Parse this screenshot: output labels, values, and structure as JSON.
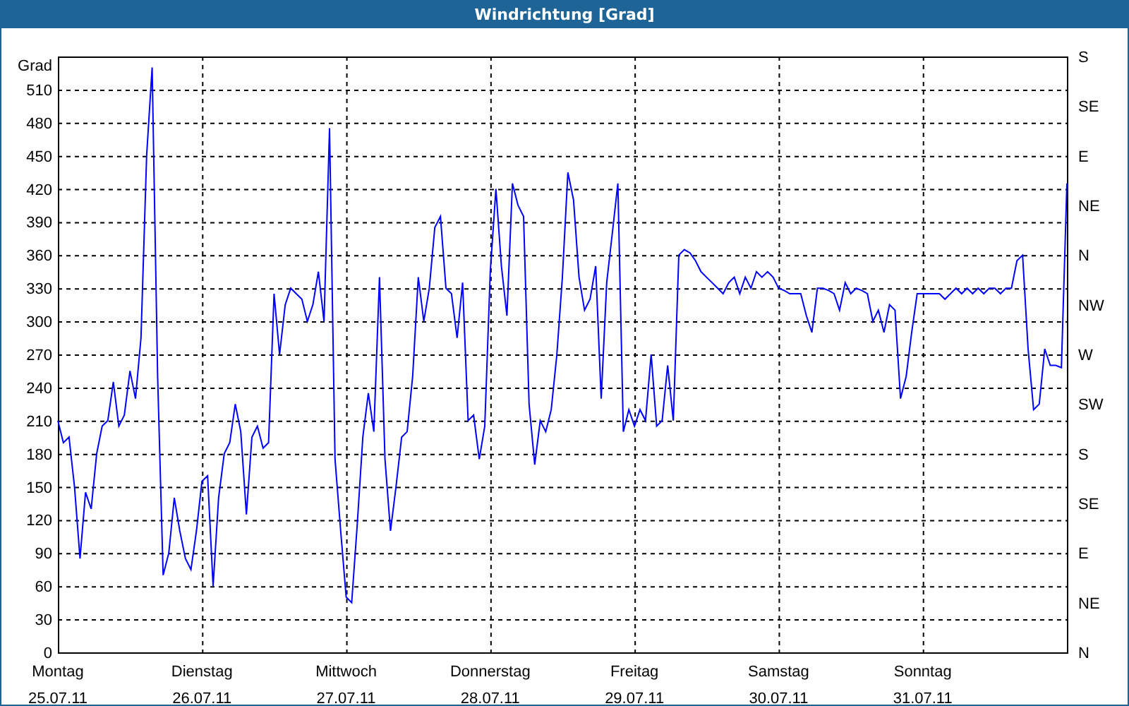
{
  "chart": {
    "chart_data": {
      "type": "line",
      "title": "Windrichtung [Grad]",
      "ylabel": "Grad",
      "categories": [
        "Montag\n25.07.11",
        null,
        null,
        null,
        null,
        null,
        null,
        null,
        null,
        null,
        null,
        null,
        null,
        null,
        null,
        null,
        null,
        null,
        null,
        null,
        null,
        null,
        null,
        null,
        null,
        null,
        "Dienstag\n26.07.11",
        null,
        null,
        null,
        null,
        null,
        null,
        null,
        null,
        null,
        null,
        null,
        null,
        null,
        null,
        null,
        null,
        null,
        null,
        null,
        null,
        null,
        null,
        null,
        null,
        null,
        "Mittwoch\n27.07.11",
        null,
        null,
        null,
        null,
        null,
        null,
        null,
        null,
        null,
        null,
        null,
        null,
        null,
        null,
        null,
        null,
        null,
        null,
        null,
        null,
        null,
        null,
        null,
        null,
        null,
        "Donnerstag\n28.07.11",
        null,
        null,
        null,
        null,
        null,
        null,
        null,
        null,
        null,
        null,
        null,
        null,
        null,
        null,
        null,
        null,
        null,
        null,
        null,
        null,
        null,
        null,
        null,
        null,
        null,
        "Freitag\n29.07.11",
        null,
        null,
        null,
        null,
        null,
        null,
        null,
        null,
        null,
        null,
        null,
        null,
        null,
        null,
        null,
        null,
        null,
        null,
        null,
        null,
        null,
        null,
        null,
        null,
        null,
        "Samstag\n30.07.11",
        null,
        null,
        null,
        null,
        null,
        null,
        null,
        null,
        null,
        null,
        null,
        null,
        null,
        null,
        null,
        null,
        null,
        null,
        null,
        null,
        null,
        null,
        null,
        null,
        null,
        "Sonntag\n31.07.11",
        null,
        null,
        null,
        null,
        null,
        null,
        null,
        null,
        null,
        null,
        null,
        null,
        null,
        null,
        null,
        null,
        null,
        null,
        null,
        null,
        null,
        null,
        null,
        null,
        null,
        null
      ],
      "series": [
        {
          "color": "#0000ff",
          "values": [
            210,
            190,
            195,
            150,
            85,
            145,
            130,
            180,
            205,
            210,
            245,
            205,
            215,
            255,
            230,
            285,
            450,
            530,
            250,
            70,
            90,
            140,
            110,
            85,
            75,
            110,
            155,
            160,
            60,
            140,
            180,
            190,
            225,
            200,
            125,
            195,
            205,
            185,
            190,
            325,
            270,
            315,
            330,
            325,
            320,
            300,
            315,
            345,
            300,
            475,
            175,
            110,
            50,
            45,
            115,
            195,
            235,
            200,
            340,
            175,
            110,
            150,
            195,
            200,
            250,
            340,
            300,
            330,
            385,
            395,
            330,
            325,
            285,
            335,
            210,
            215,
            175,
            205,
            345,
            420,
            350,
            305,
            425,
            405,
            395,
            225,
            170,
            210,
            200,
            220,
            270,
            340,
            435,
            410,
            340,
            310,
            320,
            350,
            230,
            335,
            380,
            425,
            200,
            220,
            205,
            220,
            210,
            270,
            205,
            210,
            260,
            210,
            360,
            365,
            362,
            355,
            345,
            340,
            335,
            330,
            325,
            335,
            340,
            325,
            340,
            330,
            345,
            340,
            345,
            340,
            330,
            328,
            325,
            325,
            325,
            305,
            290,
            330,
            330,
            328,
            325,
            310,
            335,
            325,
            330,
            328,
            325,
            300,
            310,
            290,
            315,
            310,
            230,
            250,
            290,
            325,
            325,
            325,
            325,
            325,
            320,
            325,
            330,
            325,
            330,
            325,
            330,
            325,
            330,
            330,
            325,
            330,
            330,
            355,
            360,
            275,
            220,
            225,
            275,
            260,
            260,
            258,
            425
          ]
        }
      ],
      "grid": true,
      "ylim": [
        0,
        540
      ],
      "yticks": [
        0,
        30,
        60,
        90,
        120,
        150,
        180,
        210,
        240,
        270,
        300,
        330,
        360,
        390,
        420,
        450,
        480,
        510
      ]
    },
    "compass_labels": [
      "S",
      "SE",
      "E",
      "NE",
      "N",
      "NW",
      "W",
      "SW",
      "S",
      "SE",
      "E",
      "NE",
      "N"
    ]
  }
}
